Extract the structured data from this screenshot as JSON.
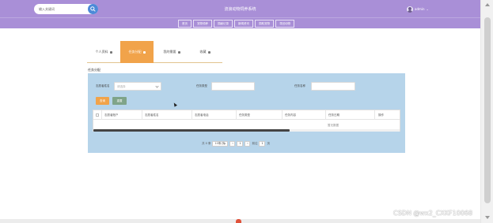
{
  "header": {
    "search_placeholder": "输入关键词",
    "site_title": "流浪动物饲养系统",
    "user_name": "admin"
  },
  "menu": {
    "items": [
      "首页",
      "宠物领养",
      "捐献记录",
      "新闻资讯",
      "捐助宠物",
      "寻回动物"
    ]
  },
  "tabs": {
    "items": [
      {
        "label": "个人资料"
      },
      {
        "label": "任务分配"
      },
      {
        "label": "我的需要"
      },
      {
        "label": "收藏"
      }
    ]
  },
  "section_title": "任务分配",
  "filters": {
    "field1_label": "志愿者姓名",
    "field1_value": "请选择",
    "field2_label": "任务类型",
    "field2_value": "",
    "field3_label": "任务名称",
    "field3_value": ""
  },
  "buttons": {
    "search": "查询",
    "reset": "重置"
  },
  "table": {
    "columns": [
      "志愿者账户",
      "志愿者姓名",
      "志愿者电话",
      "任务类型",
      "任务内容",
      "任务日期",
      "操作"
    ],
    "empty_text": "暂无数据"
  },
  "pagination": {
    "total_label": "共 0 条",
    "page_size": "10条/页",
    "prev": "<",
    "next": ">",
    "current_page": "1",
    "goto_label": "前往",
    "goto_value": "1",
    "page_suffix": "页"
  },
  "watermark": "CSDN @wx2_CXKF10068"
}
